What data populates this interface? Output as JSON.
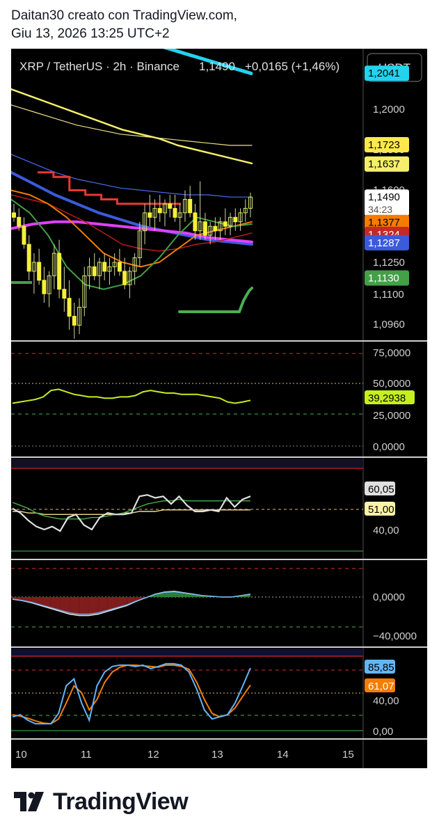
{
  "header": {
    "line1": "Daitan30 creato con TradingView.com,",
    "line2": "Giu 13, 2026 13:25 UTC+2"
  },
  "footer": {
    "brand": "TradingView"
  },
  "colors": {
    "background": "#000000",
    "cyan": "#22d3ee",
    "yellow": "#f5ef6b",
    "pale_yellow": "#f0e08a",
    "blue": "#3b5bdb",
    "magenta": "#e040fb",
    "orange": "#f57c00",
    "red": "#c62828",
    "green": "#43a047",
    "lime": "#c6ef1f",
    "light_blue": "#64b5f6"
  },
  "chart_data": [
    {
      "type": "candlestick",
      "pane": "price",
      "title": "XRP / TetherUS · 2h · Binance",
      "symbol_readout": {
        "price": "1,1490",
        "change": "+0,0165 (+1,46%)"
      },
      "currency_button": "USDT",
      "x_ticks": [
        "10",
        "11",
        "12",
        "13",
        "14",
        "15"
      ],
      "y_ticks": [
        "1,2000",
        "1,1800",
        "1,1600",
        "1,1250",
        "1,1100",
        "1,0960"
      ],
      "ylim": [
        1.085,
        1.215
      ],
      "price_labels": [
        {
          "text": "1,2041",
          "value": 1.2041,
          "color": "#22d3ee",
          "text_color": "#000000"
        },
        {
          "text": "1,1723",
          "value": 1.1723,
          "color": "#ffe84d",
          "text_color": "#000000"
        },
        {
          "text": "1,1637",
          "value": 1.1637,
          "color": "#f5ef6b",
          "text_color": "#000000"
        },
        {
          "text": "1,1490",
          "value": 1.149,
          "color": "#ffffff",
          "text_color": "#000000",
          "sub": "34:23"
        },
        {
          "text": "1,1377",
          "value": 1.1377,
          "color": "#f57c00",
          "text_color": "#000000"
        },
        {
          "text": "1,1324",
          "value": 1.1324,
          "color": "#c62828",
          "text_color": "#ffffff"
        },
        {
          "text": "1,1287",
          "value": 1.1287,
          "color": "#3b5bdb",
          "text_color": "#ffffff"
        },
        {
          "text": "1,1130",
          "value": 1.113,
          "color": "#43a047",
          "text_color": "#ffffff"
        }
      ],
      "candles": [
        [
          1.142,
          1.146,
          1.138,
          1.14
        ],
        [
          1.14,
          1.144,
          1.134,
          1.136
        ],
        [
          1.136,
          1.14,
          1.126,
          1.128
        ],
        [
          1.128,
          1.132,
          1.112,
          1.116
        ],
        [
          1.116,
          1.124,
          1.106,
          1.12
        ],
        [
          1.12,
          1.126,
          1.11,
          1.112
        ],
        [
          1.112,
          1.118,
          1.102,
          1.106
        ],
        [
          1.106,
          1.116,
          1.1,
          1.114
        ],
        [
          1.114,
          1.128,
          1.108,
          1.124
        ],
        [
          1.124,
          1.13,
          1.104,
          1.108
        ],
        [
          1.108,
          1.118,
          1.098,
          1.104
        ],
        [
          1.104,
          1.112,
          1.09,
          1.096
        ],
        [
          1.096,
          1.102,
          1.086,
          1.092
        ],
        [
          1.092,
          1.104,
          1.088,
          1.1
        ],
        [
          1.1,
          1.118,
          1.096,
          1.114
        ],
        [
          1.114,
          1.122,
          1.108,
          1.118
        ],
        [
          1.118,
          1.124,
          1.112,
          1.114
        ],
        [
          1.114,
          1.122,
          1.108,
          1.12
        ],
        [
          1.12,
          1.124,
          1.112,
          1.116
        ],
        [
          1.116,
          1.122,
          1.11,
          1.118
        ],
        [
          1.118,
          1.124,
          1.114,
          1.12
        ],
        [
          1.12,
          1.126,
          1.114,
          1.116
        ],
        [
          1.116,
          1.122,
          1.108,
          1.11
        ],
        [
          1.11,
          1.118,
          1.104,
          1.116
        ],
        [
          1.116,
          1.124,
          1.11,
          1.122
        ],
        [
          1.122,
          1.138,
          1.118,
          1.134
        ],
        [
          1.134,
          1.146,
          1.128,
          1.142
        ],
        [
          1.142,
          1.15,
          1.136,
          1.14
        ],
        [
          1.14,
          1.148,
          1.134,
          1.144
        ],
        [
          1.144,
          1.15,
          1.138,
          1.142
        ],
        [
          1.142,
          1.148,
          1.136,
          1.146
        ],
        [
          1.146,
          1.15,
          1.14,
          1.144
        ],
        [
          1.144,
          1.15,
          1.138,
          1.14
        ],
        [
          1.14,
          1.146,
          1.134,
          1.142
        ],
        [
          1.142,
          1.152,
          1.138,
          1.148
        ],
        [
          1.148,
          1.154,
          1.14,
          1.142
        ],
        [
          1.142,
          1.146,
          1.13,
          1.134
        ],
        [
          1.134,
          1.156,
          1.13,
          1.138
        ],
        [
          1.138,
          1.142,
          1.13,
          1.132
        ],
        [
          1.132,
          1.138,
          1.128,
          1.136
        ],
        [
          1.136,
          1.14,
          1.13,
          1.134
        ],
        [
          1.134,
          1.14,
          1.13,
          1.138
        ],
        [
          1.138,
          1.144,
          1.132,
          1.136
        ],
        [
          1.136,
          1.142,
          1.132,
          1.14
        ],
        [
          1.14,
          1.144,
          1.134,
          1.138
        ],
        [
          1.138,
          1.144,
          1.134,
          1.142
        ],
        [
          1.142,
          1.148,
          1.138,
          1.144
        ],
        [
          1.144,
          1.151,
          1.14,
          1.149
        ]
      ],
      "overlays": [
        {
          "name": "cyan",
          "color": "#22d3ee",
          "width": 5,
          "values": [
            1.224,
            1.223,
            1.222,
            1.221,
            1.22,
            1.219,
            1.218,
            1.217,
            1.216,
            1.215,
            1.214,
            1.213,
            1.212,
            1.211,
            1.21,
            1.209,
            1.208,
            1.207,
            1.206,
            1.205,
            1.204
          ]
        },
        {
          "name": "yellow",
          "color": "#f5ef6b",
          "width": 2.5,
          "values": [
            1.197,
            1.194,
            1.191,
            1.188,
            1.185,
            1.182,
            1.179,
            1.177,
            1.175,
            1.172,
            1.17,
            1.168,
            1.166,
            1.164
          ]
        },
        {
          "name": "pale-yellow",
          "color": "#f0e08a",
          "width": 1.2,
          "values": [
            1.19,
            1.187,
            1.184,
            1.181,
            1.179,
            1.177,
            1.176,
            1.175,
            1.174,
            1.173,
            1.172,
            1.172
          ]
        },
        {
          "name": "blue-thin",
          "color": "#4a6cf7",
          "width": 1.2,
          "values": [
            1.168,
            1.164,
            1.16,
            1.157,
            1.155,
            1.153,
            1.152,
            1.151,
            1.15,
            1.15,
            1.149,
            1.149
          ]
        },
        {
          "name": "blue-thick",
          "color": "#3b5bdb",
          "width": 4,
          "values": [
            1.16,
            1.155,
            1.15,
            1.146,
            1.142,
            1.139,
            1.136,
            1.134,
            1.132,
            1.13,
            1.129,
            1.128
          ]
        },
        {
          "name": "magenta",
          "color": "#e040fb",
          "width": 4,
          "values": [
            1.135,
            1.137,
            1.138,
            1.138,
            1.137,
            1.136,
            1.135,
            1.134,
            1.133,
            1.131,
            1.13,
            1.129
          ]
        },
        {
          "name": "dark-red",
          "color": "#b71c1c",
          "width": 1.5,
          "values": [
            1.15,
            1.148,
            1.146,
            1.142,
            1.138,
            1.133,
            1.128,
            1.126,
            1.125,
            1.126,
            1.128,
            1.129,
            1.131,
            1.133
          ]
        },
        {
          "name": "orange",
          "color": "#f57c00",
          "width": 2,
          "values": [
            1.152,
            1.15,
            1.146,
            1.14,
            1.132,
            1.124,
            1.12,
            1.118,
            1.12,
            1.126,
            1.132,
            1.134,
            1.136,
            1.138
          ]
        },
        {
          "name": "green",
          "color": "#43a047",
          "width": 2,
          "values": [
            1.148,
            1.142,
            1.132,
            1.118,
            1.11,
            1.108,
            1.11,
            1.114,
            1.122,
            1.132,
            1.14,
            1.138,
            1.136,
            1.137
          ]
        },
        {
          "name": "red-step",
          "color": "#e53935",
          "width": 3,
          "values": [
            1.16,
            1.158,
            1.152,
            1.15,
            1.148,
            1.146,
            1.146,
            1.146,
            1.146
          ]
        }
      ]
    },
    {
      "type": "line",
      "pane": "indicator-1",
      "y_ticks": [
        "75,0000",
        "50,0000",
        "25,0000",
        "0,0000"
      ],
      "ylim": [
        0,
        80
      ],
      "last_value_label": "39,2938",
      "values": [
        37,
        38,
        39,
        40,
        42,
        47,
        48,
        46,
        44,
        43,
        42,
        42,
        41,
        41,
        42,
        42,
        43,
        46,
        47,
        46,
        45,
        45,
        44,
        44,
        44,
        43,
        42,
        41,
        38,
        37,
        38,
        39.3
      ]
    },
    {
      "type": "line",
      "pane": "indicator-2",
      "y_ticks": [
        "40,00"
      ],
      "ylim": [
        20,
        80
      ],
      "labels": [
        "60,05",
        "51,00"
      ],
      "series": [
        {
          "color": "#e0e0e0",
          "values": [
            52,
            49,
            44,
            40,
            38,
            40,
            37,
            46,
            48,
            41,
            38,
            46,
            49,
            48,
            48,
            49,
            60,
            61,
            59,
            60,
            55,
            60,
            54,
            50,
            50,
            51,
            50,
            59,
            53,
            58,
            60.05
          ]
        },
        {
          "color": "#4caf50",
          "values": [
            56,
            54,
            52,
            49,
            47,
            46,
            45,
            45,
            45,
            45,
            46,
            46,
            47,
            48,
            49,
            51,
            53,
            55,
            56,
            57,
            57,
            58,
            57,
            57,
            57,
            57,
            57,
            57,
            57,
            57,
            57
          ]
        },
        {
          "color": "#f0e08a",
          "values": [
            50,
            50,
            49,
            49,
            48,
            48,
            48,
            48,
            48,
            48,
            48,
            48,
            48,
            48,
            49,
            49,
            50,
            50,
            50,
            51,
            51,
            51,
            51,
            51,
            51,
            51,
            51,
            51,
            51,
            51,
            51
          ]
        }
      ]
    },
    {
      "type": "area",
      "pane": "indicator-3",
      "y_ticks": [
        "0,0000",
        "−40,0000"
      ],
      "ylim": [
        -55,
        45
      ],
      "values": [
        -3,
        -5,
        -8,
        -12,
        -16,
        -20,
        -24,
        -26,
        -26,
        -24,
        -20,
        -16,
        -12,
        -6,
        -1,
        4,
        7,
        8,
        6,
        4,
        2,
        1,
        0,
        0,
        2,
        4
      ]
    },
    {
      "type": "line",
      "pane": "indicator-4",
      "y_ticks": [
        "40,00",
        "0,00"
      ],
      "ylim": [
        -5,
        105
      ],
      "labels": [
        "85,85",
        "61,07"
      ],
      "series": [
        {
          "color": "#64b5f6",
          "values": [
            15,
            18,
            10,
            5,
            5,
            5,
            20,
            60,
            70,
            35,
            10,
            60,
            80,
            88,
            90,
            90,
            88,
            90,
            85,
            88,
            92,
            92,
            90,
            80,
            55,
            25,
            12,
            15,
            18,
            35,
            60,
            85.85
          ]
        },
        {
          "color": "#f57c00",
          "values": [
            18,
            16,
            13,
            9,
            6,
            5,
            12,
            35,
            60,
            50,
            25,
            40,
            65,
            80,
            87,
            90,
            90,
            89,
            88,
            87,
            90,
            90,
            88,
            84,
            65,
            40,
            20,
            15,
            18,
            28,
            45,
            61.07
          ]
        }
      ]
    }
  ]
}
